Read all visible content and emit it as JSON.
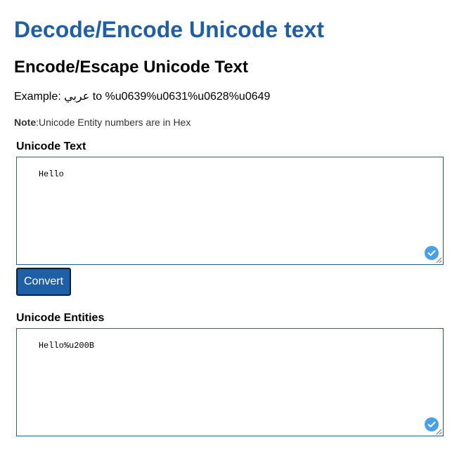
{
  "header": {
    "title": "Decode/Encode Unicode text",
    "subtitle": "Encode/Escape Unicode Text"
  },
  "example": {
    "prefix": "Example: ",
    "arabic_text": "عربي",
    "middle": " to ",
    "encoded": "%u0639%u0631%u0628%u0649"
  },
  "note": {
    "bold": "Note",
    "text": ":Unicode Entity numbers are in Hex"
  },
  "input_section": {
    "label": "Unicode Text",
    "value": "Hello",
    "check_icon": "check-circle-icon",
    "resize_icon": "resize-handle-icon"
  },
  "convert_button": {
    "label": "Convert"
  },
  "output_section": {
    "label": "Unicode Entities",
    "value": "Hello%u200B",
    "check_icon": "check-circle-icon",
    "resize_icon": "resize-handle-icon"
  },
  "colors": {
    "title": "#1f5fa6",
    "button_bg": "#1f5fa6",
    "textbox_border": "#1f5fa6",
    "check_icon": "#4a9fea"
  }
}
